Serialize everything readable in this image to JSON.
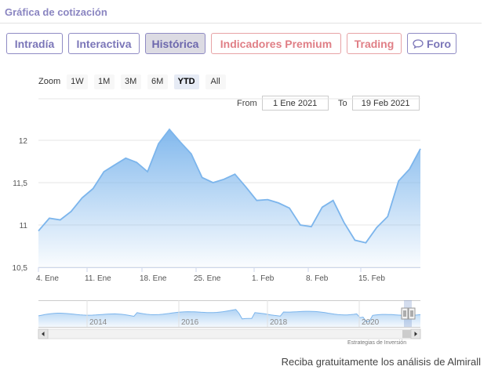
{
  "header": {
    "title": "Gráfica de cotización"
  },
  "tabs": [
    {
      "label": "Intradía",
      "style": "normal"
    },
    {
      "label": "Interactiva",
      "style": "normal"
    },
    {
      "label": "Histórica",
      "style": "active"
    },
    {
      "label": "Indicadores Premium",
      "style": "premium"
    },
    {
      "label": "Trading",
      "style": "premium"
    },
    {
      "label": "Foro",
      "style": "normal",
      "icon": "chat-bubble-icon"
    }
  ],
  "zoom": {
    "label": "Zoom",
    "buttons": [
      "1W",
      "1M",
      "3M",
      "6M",
      "YTD",
      "All"
    ],
    "active": "YTD"
  },
  "range": {
    "from_label": "From",
    "from_value": "1 Ene 2021",
    "to_label": "To",
    "to_value": "19 Feb 2021"
  },
  "chart_data": {
    "type": "area",
    "y_ticks": [
      "12",
      "11,5",
      "11",
      "10,5"
    ],
    "ylim": [
      10.5,
      12.3
    ],
    "x_ticks": [
      "4. Ene",
      "11. Ene",
      "18. Ene",
      "25. Ene",
      "1. Feb",
      "8. Feb",
      "15. Feb"
    ],
    "x": [
      "2021-01-04",
      "2021-01-05",
      "2021-01-06",
      "2021-01-07",
      "2021-01-08",
      "2021-01-11",
      "2021-01-12",
      "2021-01-13",
      "2021-01-14",
      "2021-01-15",
      "2021-01-18",
      "2021-01-19",
      "2021-01-20",
      "2021-01-21",
      "2021-01-22",
      "2021-01-25",
      "2021-01-26",
      "2021-01-27",
      "2021-01-28",
      "2021-01-29",
      "2021-02-01",
      "2021-02-02",
      "2021-02-03",
      "2021-02-04",
      "2021-02-05",
      "2021-02-08",
      "2021-02-09",
      "2021-02-10",
      "2021-02-11",
      "2021-02-12",
      "2021-02-15",
      "2021-02-16",
      "2021-02-17",
      "2021-02-18",
      "2021-02-19"
    ],
    "values": [
      10.93,
      11.08,
      11.06,
      11.16,
      11.32,
      11.43,
      11.63,
      11.71,
      11.79,
      11.74,
      11.63,
      11.96,
      12.13,
      11.98,
      11.84,
      11.56,
      11.5,
      11.54,
      11.6,
      11.45,
      11.29,
      11.3,
      11.26,
      11.2,
      11.0,
      10.98,
      11.21,
      11.29,
      11.03,
      10.82,
      10.79,
      10.97,
      11.1,
      11.52,
      11.66,
      11.9
    ],
    "color": "#7cb5ec",
    "grid": true,
    "navigator": {
      "x_ticks": [
        "2014",
        "2016",
        "2018",
        "2020"
      ]
    }
  },
  "credit": "Estrategias de Inversión",
  "footer": {
    "text": "Reciba gratuitamente los análisis de Almirall"
  }
}
